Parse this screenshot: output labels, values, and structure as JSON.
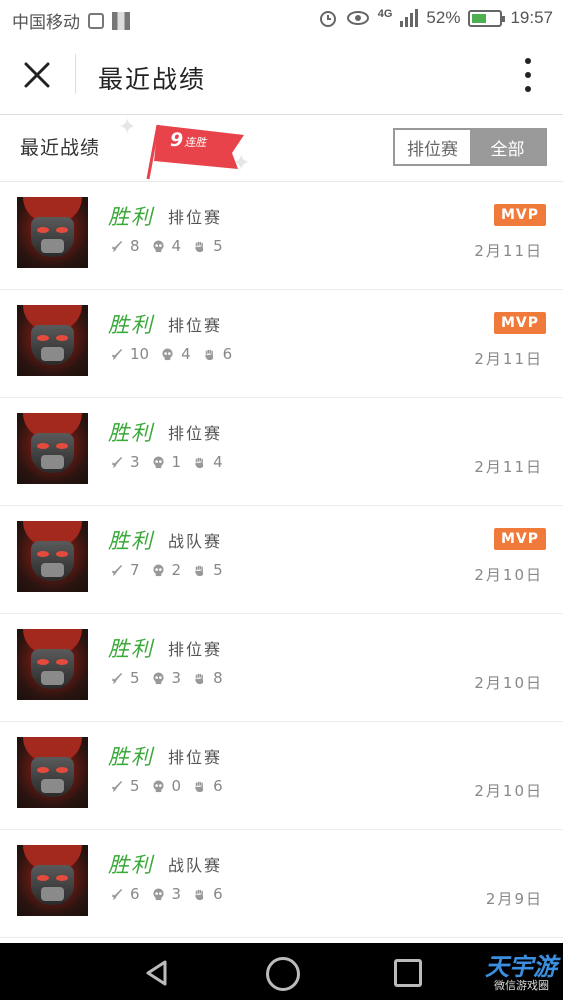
{
  "status_bar": {
    "carrier": "中国移动",
    "network": "4G",
    "battery": "52%",
    "battery_level": 0.52,
    "time": "19:57"
  },
  "header": {
    "title": "最近战绩"
  },
  "section": {
    "title": "最近战绩",
    "streak_number": "9",
    "streak_label": "连胜",
    "filters": [
      {
        "label": "排位赛",
        "active": false
      },
      {
        "label": "全部",
        "active": true
      }
    ]
  },
  "matches": [
    {
      "result": "胜利",
      "mode": "排位赛",
      "kills": "8",
      "deaths": "4",
      "assists": "5",
      "mvp": "MVP",
      "date": "2月11日"
    },
    {
      "result": "胜利",
      "mode": "排位赛",
      "kills": "10",
      "deaths": "4",
      "assists": "6",
      "mvp": "MVP",
      "date": "2月11日"
    },
    {
      "result": "胜利",
      "mode": "排位赛",
      "kills": "3",
      "deaths": "1",
      "assists": "4",
      "mvp": "",
      "date": "2月11日"
    },
    {
      "result": "胜利",
      "mode": "战队赛",
      "kills": "7",
      "deaths": "2",
      "assists": "5",
      "mvp": "MVP",
      "date": "2月10日"
    },
    {
      "result": "胜利",
      "mode": "排位赛",
      "kills": "5",
      "deaths": "3",
      "assists": "8",
      "mvp": "",
      "date": "2月10日"
    },
    {
      "result": "胜利",
      "mode": "排位赛",
      "kills": "5",
      "deaths": "0",
      "assists": "6",
      "mvp": "",
      "date": "2月10日"
    },
    {
      "result": "胜利",
      "mode": "战队赛",
      "kills": "6",
      "deaths": "3",
      "assists": "6",
      "mvp": "",
      "date": "2月9日"
    }
  ],
  "watermark": {
    "main": "天宇游",
    "sub": "微信游戏圈"
  },
  "colors": {
    "win": "#3aa83a",
    "mvp": "#f07a3a",
    "flag": "#e8424a"
  }
}
